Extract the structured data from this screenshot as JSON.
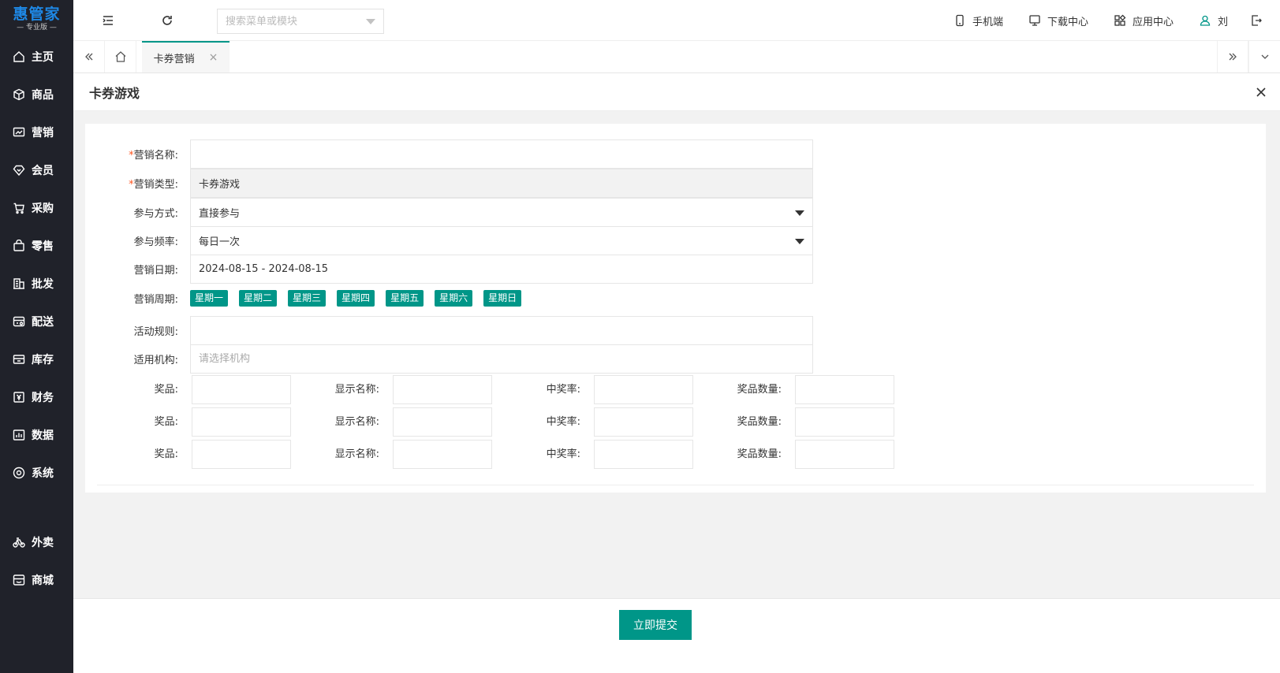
{
  "app": {
    "logo_main": "惠管家",
    "logo_sub": "— 专业版 —"
  },
  "sidebar": {
    "items": [
      {
        "label": "主页",
        "icon": "home-icon"
      },
      {
        "label": "商品",
        "icon": "box-icon"
      },
      {
        "label": "营销",
        "icon": "chart-icon"
      },
      {
        "label": "会员",
        "icon": "diamond-icon"
      },
      {
        "label": "采购",
        "icon": "cart-icon"
      },
      {
        "label": "零售",
        "icon": "bag-icon"
      },
      {
        "label": "批发",
        "icon": "building-icon"
      },
      {
        "label": "配送",
        "icon": "delivery-icon"
      },
      {
        "label": "库存",
        "icon": "archive-icon"
      },
      {
        "label": "财务",
        "icon": "yen-icon"
      },
      {
        "label": "数据",
        "icon": "data-icon"
      },
      {
        "label": "系统",
        "icon": "settings-icon"
      }
    ],
    "extra_items": [
      {
        "label": "外卖",
        "icon": "bike-icon"
      },
      {
        "label": "商城",
        "icon": "store-icon"
      }
    ]
  },
  "header": {
    "search_placeholder": "搜索菜单或模块",
    "mobile_label": "手机端",
    "download_label": "下载中心",
    "app_center_label": "应用中心",
    "user_name": "刘"
  },
  "tabs": {
    "active_label": "卡券营销",
    "close_glyph": "×"
  },
  "page": {
    "title": "卡券游戏",
    "close_glyph": "✕"
  },
  "form": {
    "name_label": "营销名称:",
    "name_value": "",
    "type_label": "营销类型:",
    "type_value": "卡券游戏",
    "join_label": "参与方式:",
    "join_value": "直接参与",
    "freq_label": "参与频率:",
    "freq_value": "每日一次",
    "date_label": "营销日期:",
    "date_value": "2024-08-15 - 2024-08-15",
    "cycle_label": "营销周期:",
    "weekdays": [
      "星期一",
      "星期二",
      "星期三",
      "星期四",
      "星期五",
      "星期六",
      "星期日"
    ],
    "rule_label": "活动规则:",
    "rule_value": "",
    "org_label": "适用机构:",
    "org_placeholder": "请选择机构",
    "required_mark": "*",
    "prize_rows": [
      {
        "prize_label": "奖品:",
        "display_label": "显示名称:",
        "rate_label": "中奖率:",
        "qty_label": "奖品数量:"
      },
      {
        "prize_label": "奖品:",
        "display_label": "显示名称:",
        "rate_label": "中奖率:",
        "qty_label": "奖品数量:"
      },
      {
        "prize_label": "奖品:",
        "display_label": "显示名称:",
        "rate_label": "中奖率:",
        "qty_label": "奖品数量:"
      }
    ]
  },
  "footer": {
    "submit_label": "立即提交"
  },
  "colors": {
    "accent": "#009688",
    "sidebar_bg": "#20222a",
    "logo_blue": "#1e88e5",
    "required": "#ff5722"
  }
}
